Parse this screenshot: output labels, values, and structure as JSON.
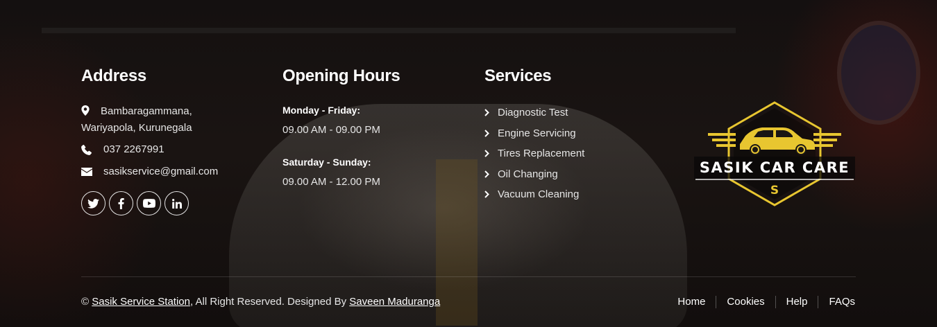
{
  "address": {
    "title": "Address",
    "location_line1": "Bambaragammana,",
    "location_line2": "Wariyapola, Kurunegala",
    "phone": "037 2267991",
    "email": "sasikservice@gmail.com",
    "socials": [
      {
        "name": "twitter-icon"
      },
      {
        "name": "facebook-icon"
      },
      {
        "name": "youtube-icon"
      },
      {
        "name": "linkedin-icon"
      }
    ]
  },
  "hours": {
    "title": "Opening Hours",
    "weekday_label": "Monday - Friday:",
    "weekday_time": "09.00 AM - 09.00 PM",
    "weekend_label": "Saturday - Sunday:",
    "weekend_time": "09.00 AM - 12.00 PM"
  },
  "services": {
    "title": "Services",
    "items": [
      "Diagnostic Test",
      "Engine Servicing",
      "Tires Replacement",
      "Oil Changing",
      "Vacuum Cleaning"
    ]
  },
  "logo": {
    "text": "SASIK CAR CARE",
    "letter": "S",
    "accent_color": "#e8c630"
  },
  "bottom": {
    "copyright_prefix": "©",
    "site_link": "Sasik Service Station",
    "rights_text": ", All Right Reserved. Designed By",
    "designer_link": "Saveen Maduranga",
    "nav": [
      "Home",
      "Cookies",
      "Help",
      "FAQs"
    ]
  }
}
